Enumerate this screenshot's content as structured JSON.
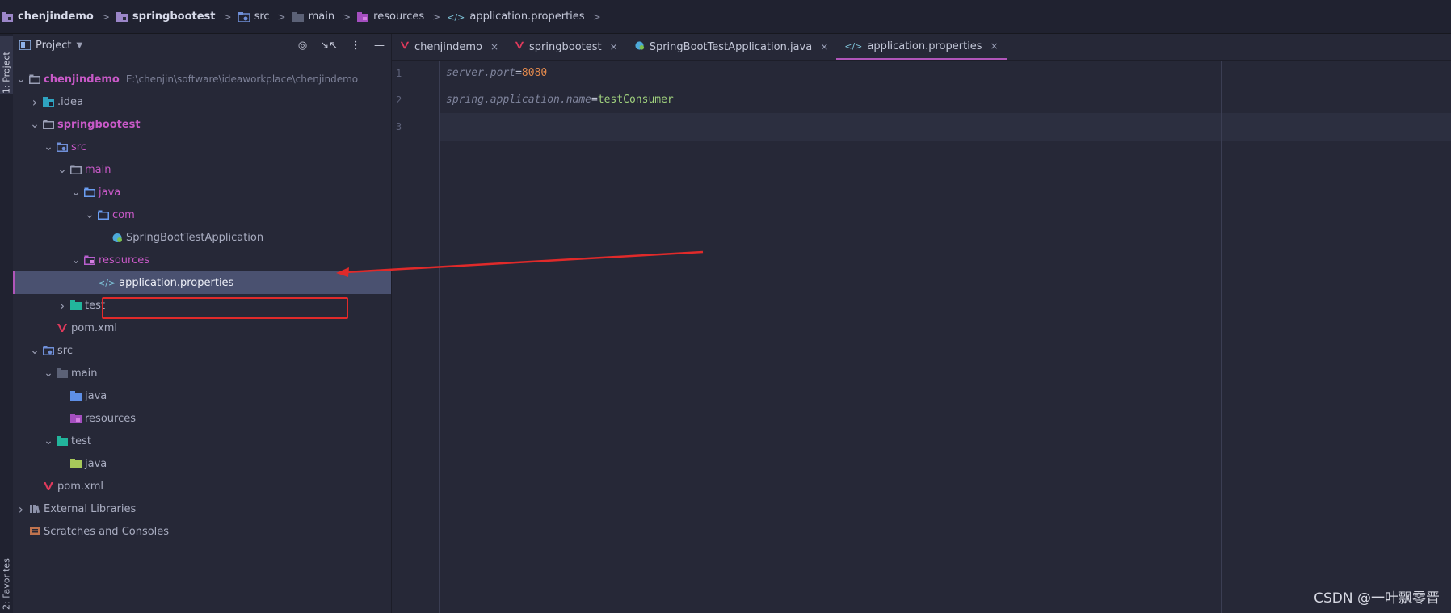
{
  "breadcrumb": [
    {
      "label": "chenjindemo",
      "icon": "project-module-icon",
      "bold": true
    },
    {
      "label": "springbootest",
      "icon": "module-icon",
      "bold": true
    },
    {
      "label": "src",
      "icon": "source-folder-icon",
      "bold": false
    },
    {
      "label": "main",
      "icon": "folder-icon",
      "bold": false
    },
    {
      "label": "resources",
      "icon": "resources-folder-icon",
      "bold": false
    },
    {
      "label": "application.properties",
      "icon": "properties-file-icon",
      "bold": false
    }
  ],
  "toolstrip": {
    "project_label": "1: Project",
    "favorites_label": "2: Favorites"
  },
  "panel": {
    "title": "Project"
  },
  "tree": [
    {
      "label": "chenjindemo",
      "path": "E:\\chenjin\\software\\ideaworkplace\\chenjindemo",
      "indent": 0,
      "arrow": "down",
      "icon": "folder",
      "style": "pinkb"
    },
    {
      "label": ".idea",
      "indent": 1,
      "arrow": "right",
      "icon": "idea-folder",
      "style": "normal"
    },
    {
      "label": "springbootest",
      "indent": 1,
      "arrow": "down",
      "icon": "folder",
      "style": "pinkb"
    },
    {
      "label": "src",
      "indent": 2,
      "arrow": "down",
      "icon": "src-folder",
      "style": "pink"
    },
    {
      "label": "main",
      "indent": 3,
      "arrow": "down",
      "icon": "folder",
      "style": "pink"
    },
    {
      "label": "java",
      "indent": 4,
      "arrow": "down",
      "icon": "java-folder",
      "style": "pink"
    },
    {
      "label": "com",
      "indent": 5,
      "arrow": "down",
      "icon": "java-folder",
      "style": "pink"
    },
    {
      "label": "SpringBootTestApplication",
      "indent": 6,
      "arrow": "",
      "icon": "springboot",
      "style": "normal"
    },
    {
      "label": "resources",
      "indent": 4,
      "arrow": "down",
      "icon": "res-folder",
      "style": "pink"
    },
    {
      "label": "application.properties",
      "indent": 5,
      "arrow": "",
      "icon": "props",
      "style": "white",
      "selected": true
    },
    {
      "label": "test",
      "indent": 3,
      "arrow": "right",
      "icon": "test-folder",
      "style": "normal"
    },
    {
      "label": "pom.xml",
      "indent": 2,
      "arrow": "",
      "icon": "maven",
      "style": "normal"
    },
    {
      "label": "src",
      "indent": 1,
      "arrow": "down",
      "icon": "src-folder",
      "style": "normal"
    },
    {
      "label": "main",
      "indent": 2,
      "arrow": "down",
      "icon": "folder-fill",
      "style": "normal"
    },
    {
      "label": "java",
      "indent": 3,
      "arrow": "",
      "icon": "java-fill",
      "style": "normal"
    },
    {
      "label": "resources",
      "indent": 3,
      "arrow": "",
      "icon": "res-fill",
      "style": "normal"
    },
    {
      "label": "test",
      "indent": 2,
      "arrow": "down",
      "icon": "test-fill",
      "style": "normal"
    },
    {
      "label": "java",
      "indent": 3,
      "arrow": "",
      "icon": "java-green",
      "style": "normal"
    },
    {
      "label": "pom.xml",
      "indent": 1,
      "arrow": "",
      "icon": "maven",
      "style": "normal"
    },
    {
      "label": "External Libraries",
      "indent": 0,
      "arrow": "right",
      "icon": "libs",
      "style": "normal"
    },
    {
      "label": "Scratches and Consoles",
      "indent": 0,
      "arrow": "",
      "icon": "scratch",
      "style": "normal"
    }
  ],
  "tabs": [
    {
      "label": "chenjindemo",
      "icon": "maven-icon",
      "active": false
    },
    {
      "label": "springbootest",
      "icon": "maven-icon",
      "active": false
    },
    {
      "label": "SpringBootTestApplication.java",
      "icon": "springboot-class-icon",
      "active": false
    },
    {
      "label": "application.properties",
      "icon": "properties-file-icon",
      "active": true
    }
  ],
  "editor": {
    "lines": [
      {
        "num": "1",
        "key": "server.port",
        "value": "8080",
        "value_type": "num"
      },
      {
        "num": "2",
        "key": "spring.application.name",
        "value": "testConsumer",
        "value_type": "str"
      },
      {
        "num": "3",
        "key": "",
        "value": "",
        "value_type": ""
      }
    ]
  },
  "watermark": "CSDN @一叶飘零晋",
  "colors": {
    "accent": "#b055b9",
    "annotation": "#e02a2a",
    "selection": "#4a5170"
  }
}
